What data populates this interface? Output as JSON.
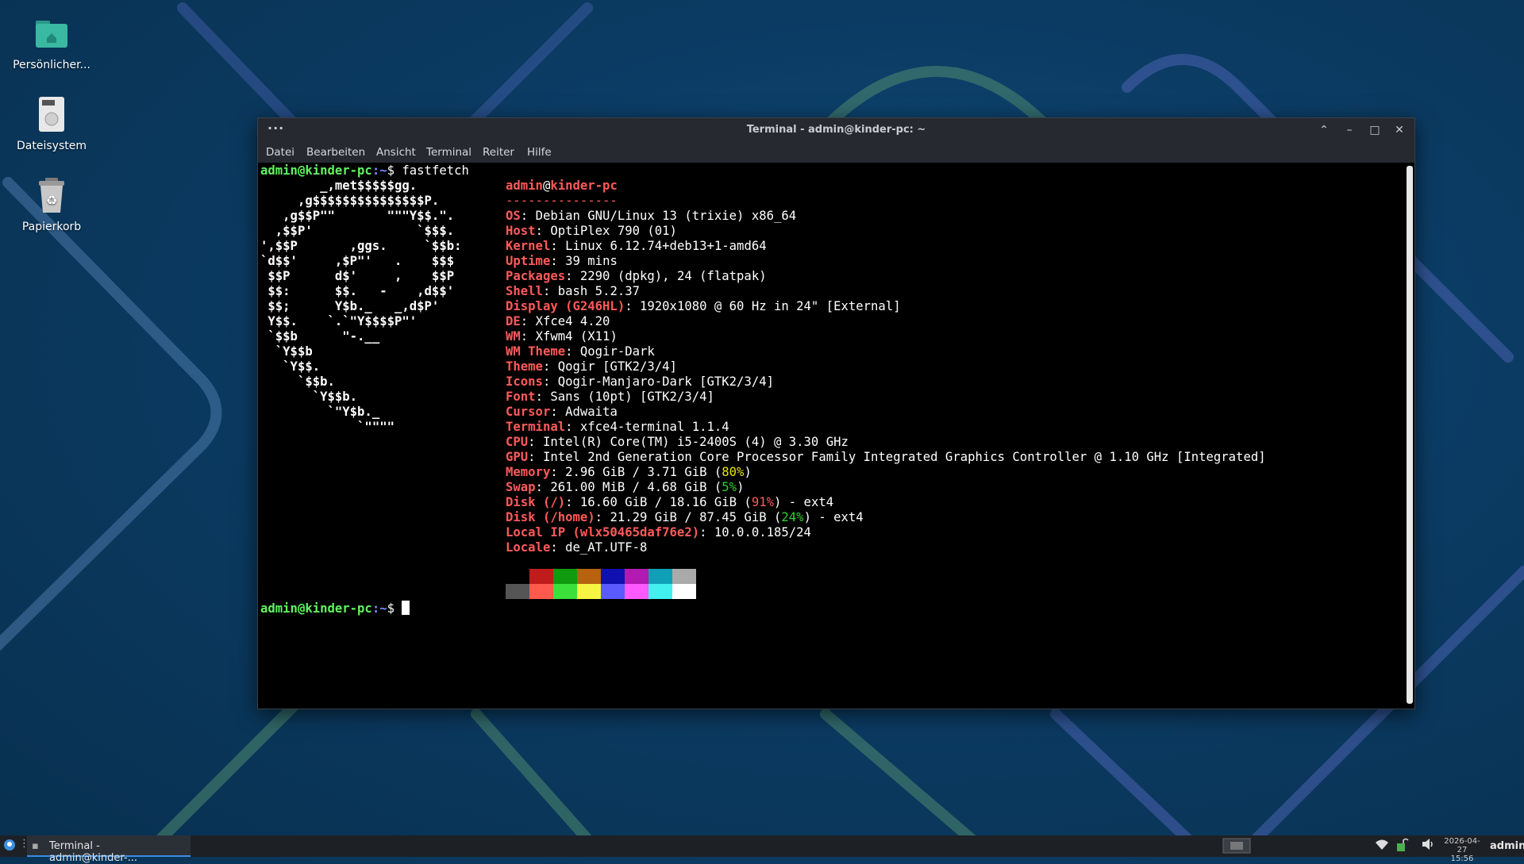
{
  "desktop": {
    "icons": [
      {
        "label": "Persönlicher..."
      },
      {
        "label": "Dateisystem"
      },
      {
        "label": "Papierkorb"
      }
    ]
  },
  "window": {
    "title": "Terminal - admin@kinder-pc: ~",
    "menu": [
      "Datei",
      "Bearbeiten",
      "Ansicht",
      "Terminal",
      "Reiter",
      "Hilfe"
    ]
  },
  "terminal": {
    "prompt_user": "admin@kinder-pc",
    "prompt_path": ":~",
    "prompt_symbol": "$",
    "command": "fastfetch",
    "logo": [
      "        _,met$$$$$gg.",
      "     ,g$$$$$$$$$$$$$$$P.",
      "   ,g$$P\"\"       \"\"\"Y$$.\".",
      "  ,$$P'              `$$$.",
      "',$$P       ,ggs.     `$$b:",
      "`d$$'     ,$P\"'   .    $$$",
      " $$P      d$'     ,    $$P",
      " $$:      $$.   -    ,d$$'",
      " $$;      Y$b._   _,d$P'",
      " Y$$.    `.`\"Y$$$$P\"'",
      " `$$b      \"-.__",
      "  `Y$$b",
      "   `Y$$.",
      "     `$$b.",
      "       `Y$$b.",
      "         `\"Y$b._",
      "             `\"\"\"\""
    ],
    "header_user": "admin",
    "header_host": "kinder-pc",
    "separator": "---------------",
    "info": [
      {
        "key": "OS",
        "value": "Debian GNU/Linux 13 (trixie) x86_64"
      },
      {
        "key": "Host",
        "value": "OptiPlex 790 (01)"
      },
      {
        "key": "Kernel",
        "value": "Linux 6.12.74+deb13+1-amd64"
      },
      {
        "key": "Uptime",
        "value": "39 mins"
      },
      {
        "key": "Packages",
        "value": "2290 (dpkg), 24 (flatpak)"
      },
      {
        "key": "Shell",
        "value": "bash 5.2.37"
      },
      {
        "key": "Display (G246HL)",
        "value": "1920x1080 @ 60 Hz in 24\" [External]"
      },
      {
        "key": "DE",
        "value": "Xfce4 4.20"
      },
      {
        "key": "WM",
        "value": "Xfwm4 (X11)"
      },
      {
        "key": "WM Theme",
        "value": "Qogir-Dark"
      },
      {
        "key": "Theme",
        "value": "Qogir [GTK2/3/4]"
      },
      {
        "key": "Icons",
        "value": "Qogir-Manjaro-Dark [GTK2/3/4]"
      },
      {
        "key": "Font",
        "value": "Sans (10pt) [GTK2/3/4]"
      },
      {
        "key": "Cursor",
        "value": "Adwaita"
      },
      {
        "key": "Terminal",
        "value": "xfce4-terminal 1.1.4"
      },
      {
        "key": "CPU",
        "value": "Intel(R) Core(TM) i5-2400S (4) @ 3.30 GHz"
      },
      {
        "key": "GPU",
        "value": "Intel 2nd Generation Core Processor Family Integrated Graphics Controller @ 1.10 GHz [Integrated]"
      },
      {
        "key": "Memory",
        "value": "2.96 GiB / 3.71 GiB (",
        "pct": "80%",
        "pct_color": "#e6e600",
        "tail": ")"
      },
      {
        "key": "Swap",
        "value": "261.00 MiB / 4.68 GiB (",
        "pct": "5%",
        "pct_color": "#2fd12f",
        "tail": ")"
      },
      {
        "key": "Disk (/)",
        "value": "16.60 GiB / 18.16 GiB (",
        "pct": "91%",
        "pct_color": "#ff5a5a",
        "tail": ") - ext4"
      },
      {
        "key": "Disk (/home)",
        "value": "21.29 GiB / 87.45 GiB (",
        "pct": "24%",
        "pct_color": "#2fd12f",
        "tail": ") - ext4"
      },
      {
        "key": "Local IP (wlx50465daf76e2)",
        "value": "10.0.0.185/24"
      },
      {
        "key": "Locale",
        "value": "de_AT.UTF-8"
      }
    ],
    "palette_top": [
      "#000000",
      "#c01c1c",
      "#0f9a0f",
      "#b8620f",
      "#1010b0",
      "#b21bb2",
      "#0fa0b8",
      "#aaaaaa"
    ],
    "palette_bottom": [
      "#555555",
      "#ff5a4d",
      "#3be03b",
      "#f5f542",
      "#5a5aff",
      "#ff5aff",
      "#42f0f0",
      "#ffffff"
    ]
  },
  "taskbar": {
    "task_label": "Terminal - admin@kinder-...",
    "date": "2026-04-27",
    "time": "15:56",
    "user": "admin"
  }
}
